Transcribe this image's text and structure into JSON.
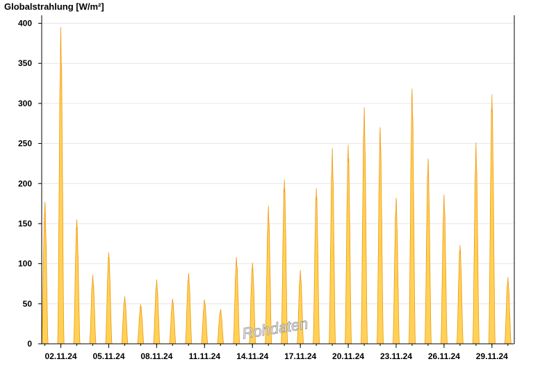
{
  "chart_data": {
    "type": "area",
    "title": "Globalstrahlung [W/m²]",
    "ylabel": "Globalstrahlung [W/m²]",
    "xlabel": "",
    "ylim": [
      0,
      410
    ],
    "xlim": [
      0.8,
      30.4
    ],
    "x_unit": "day of November 2024",
    "yticks": [
      0,
      50,
      100,
      150,
      200,
      250,
      300,
      350,
      400
    ],
    "xticks": [
      {
        "day": 2,
        "label": "02.11.24"
      },
      {
        "day": 5,
        "label": "05.11.24"
      },
      {
        "day": 8,
        "label": "08.11.24"
      },
      {
        "day": 11,
        "label": "11.11.24"
      },
      {
        "day": 14,
        "label": "14.11.24"
      },
      {
        "day": 17,
        "label": "17.11.24"
      },
      {
        "day": 20,
        "label": "20.11.24"
      },
      {
        "day": 23,
        "label": "23.11.24"
      },
      {
        "day": 26,
        "label": "26.11.24"
      },
      {
        "day": 29,
        "label": "29.11.24"
      }
    ],
    "grid": true,
    "series": [
      {
        "values": [
          {
            "date": "01.11.24",
            "peak": 177
          },
          {
            "date": "02.11.24",
            "peak": 395
          },
          {
            "date": "03.11.24",
            "peak": 155
          },
          {
            "date": "04.11.24",
            "peak": 86
          },
          {
            "date": "05.11.24",
            "peak": 114
          },
          {
            "date": "06.11.24",
            "peak": 59
          },
          {
            "date": "07.11.24",
            "peak": 49
          },
          {
            "date": "08.11.24",
            "peak": 80
          },
          {
            "date": "09.11.24",
            "peak": 56
          },
          {
            "date": "10.11.24",
            "peak": 88
          },
          {
            "date": "11.11.24",
            "peak": 55
          },
          {
            "date": "12.11.24",
            "peak": 43
          },
          {
            "date": "13.11.24",
            "peak": 108
          },
          {
            "date": "14.11.24",
            "peak": 101
          },
          {
            "date": "15.11.24",
            "peak": 172
          },
          {
            "date": "16.11.24",
            "peak": 205
          },
          {
            "date": "17.11.24",
            "peak": 92
          },
          {
            "date": "18.11.24",
            "peak": 194
          },
          {
            "date": "19.11.24",
            "peak": 244
          },
          {
            "date": "20.11.24",
            "peak": 248
          },
          {
            "date": "21.11.24",
            "peak": 295
          },
          {
            "date": "22.11.24",
            "peak": 270
          },
          {
            "date": "23.11.24",
            "peak": 182
          },
          {
            "date": "24.11.24",
            "peak": 318
          },
          {
            "date": "25.11.24",
            "peak": 231
          },
          {
            "date": "26.11.24",
            "peak": 186
          },
          {
            "date": "27.11.24",
            "peak": 123
          },
          {
            "date": "28.11.24",
            "peak": 251
          },
          {
            "date": "29.11.24",
            "peak": 311
          },
          {
            "date": "30.11.24",
            "peak": 83
          }
        ]
      }
    ],
    "watermark": "Rohdaten",
    "colors": {
      "fill": "#ffd257",
      "stroke": "#f2960a",
      "grid": "#e6e6e6",
      "axis": "#000000"
    }
  }
}
